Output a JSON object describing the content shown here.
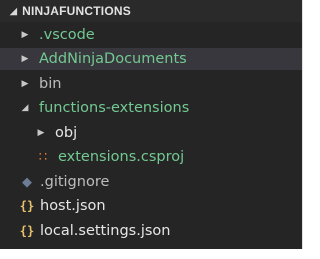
{
  "explorer": {
    "section_title": "NINJAFUNCTIONS",
    "section_caret": "◢",
    "colors": {
      "background": "#252526",
      "green": "#73c991",
      "json_icon": "#e8c26a",
      "xml_icon": "#e37933"
    },
    "items": [
      {
        "label": "vscode_label",
        "text": ".vscode",
        "twisty": "▶",
        "icon": "",
        "icon_name": "chevron-right-icon"
      },
      {
        "label": "add",
        "text": "AddNinjaDocuments",
        "twisty": "▶",
        "icon": "",
        "icon_name": "chevron-right-icon"
      },
      {
        "label": "bin",
        "text": "bin",
        "twisty": "▶",
        "icon": "",
        "icon_name": "chevron-right-icon"
      },
      {
        "label": "fx",
        "text": "functions-extensions",
        "twisty": "◢",
        "icon": "",
        "icon_name": "chevron-down-icon"
      },
      {
        "label": "obj",
        "text": "obj",
        "twisty": "▶",
        "icon": "",
        "icon_name": "chevron-right-icon"
      },
      {
        "label": "csproj",
        "text": "extensions.csproj",
        "twisty": "",
        "icon": "\u0001",
        "icon_name": "rss-icon"
      },
      {
        "label": "gitignore",
        "text": ".gitignore",
        "twisty": "",
        "icon": "◆",
        "icon_name": "git-diamond-icon"
      },
      {
        "label": "host",
        "text": "host.json",
        "twisty": "",
        "icon": "{}",
        "icon_name": "json-braces-icon"
      },
      {
        "label": "local",
        "text": "local.settings.json",
        "twisty": "",
        "icon": "{}",
        "icon_name": "json-braces-icon"
      }
    ]
  }
}
